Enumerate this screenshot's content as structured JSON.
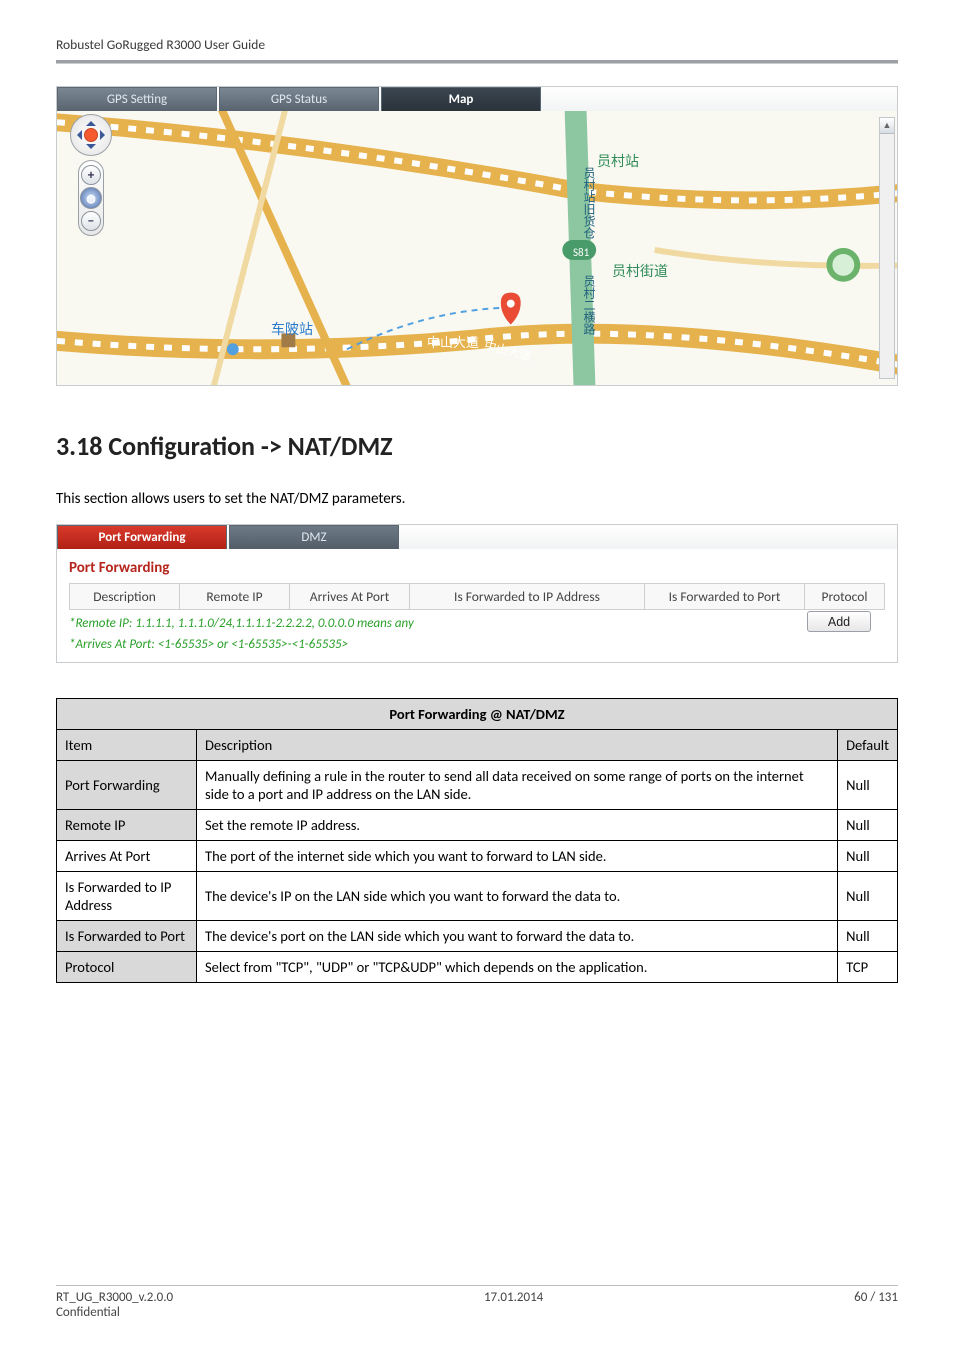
{
  "header": {
    "title": "Robustel GoRugged R3000 User Guide"
  },
  "map": {
    "tabs": [
      "GPS Setting",
      "GPS Status",
      "Map"
    ],
    "selected_tab": "Map",
    "poi_station": "员村站",
    "poi_road": "员村街道",
    "poi_chezhan": "车陂站",
    "poi_vertical": "员村站旧货仓",
    "poi_vertical2": "员村二横路",
    "poi_s81": "S81",
    "road_label": "中山大道",
    "road_label2": "中山大道",
    "controls": {
      "plus": "+",
      "globe": "◍",
      "minus": "−"
    }
  },
  "section": {
    "heading": "3.18  Configuration -> NAT/DMZ",
    "intro": "This section allows users to set the NAT/DMZ parameters."
  },
  "pf_panel": {
    "tabs": [
      "Port Forwarding",
      "DMZ"
    ],
    "title": "Port Forwarding",
    "cols": {
      "description": "Description",
      "remote_ip": "Remote IP",
      "arrives": "Arrives At Port",
      "fwd_ip": "Is Forwarded to IP Address",
      "fwd_port": "Is Forwarded to Port",
      "protocol": "Protocol"
    },
    "note1": "*Remote IP: 1.1.1.1, 1.1.1.0/24,1.1.1.1-2.2.2.2, 0.0.0.0 means any",
    "note2": "*Arrives At Port: <1-65535> or <1-65535>-<1-65535>",
    "add": "Add"
  },
  "desc_table": {
    "caption": "Port Forwarding @ NAT/DMZ",
    "head_item": "Item",
    "head_desc": "Description",
    "head_default": "Default",
    "rows": {
      "pf_item": "Port Forwarding",
      "pf_desc": "Manually defining a rule in the router to send all data received on some range of ports on the internet side to a port and IP address on the LAN side.",
      "pf_def": "Null",
      "rip_item": "Remote IP",
      "rip_desc": "Set the remote IP address.",
      "rip_def": "Null",
      "aap_item": "Arrives At Port",
      "aap_desc": "The port of the internet side which you want to forward to LAN side.",
      "aap_def": "Null",
      "fip_item": "Is Forwarded to IP Address",
      "fip_desc": "The device's IP on the LAN side which you want to forward the data to.",
      "fip_def": "Null",
      "fport_item": "Is Forwarded to Port",
      "fport_desc": "The device's port on the LAN side which you want to forward the data to.",
      "fport_def": "Null",
      "proto_item": "Protocol",
      "proto_desc": "Select from \"TCP\", \"UDP\" or \"TCP&UDP\" which depends on the application.",
      "proto_def": "TCP"
    }
  },
  "footer": {
    "doc": "RT_UG_R3000_v.2.0.0",
    "conf": "Confidential",
    "date": "17.01.2014",
    "page": "60 / 131"
  }
}
